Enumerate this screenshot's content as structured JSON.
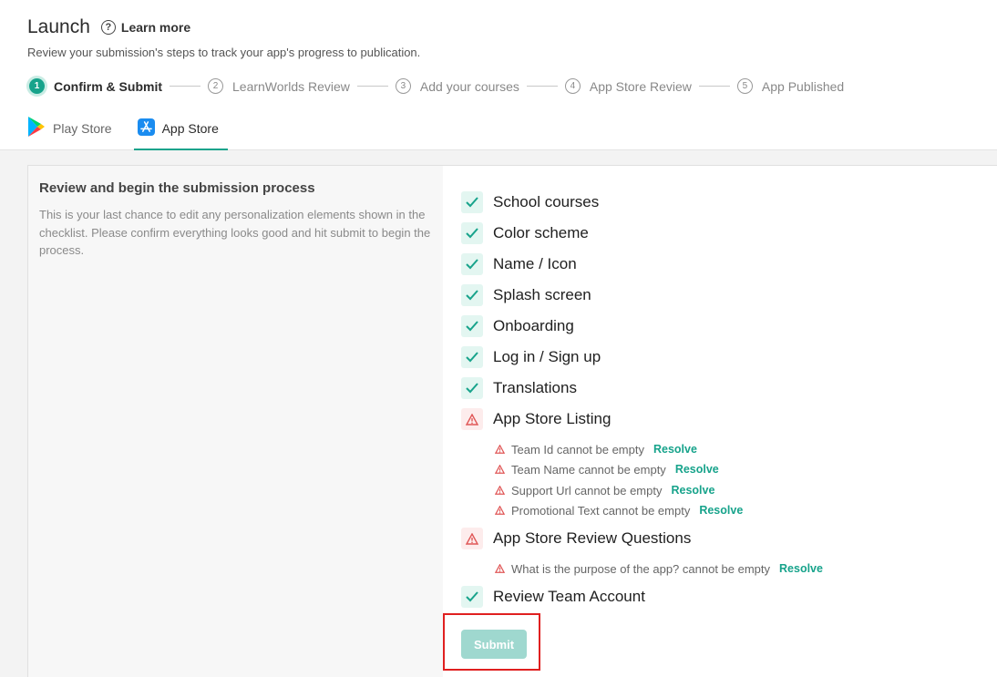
{
  "header": {
    "title": "Launch",
    "learn_more": "Learn more",
    "subtitle": "Review your submission's steps to track your app's progress to publication."
  },
  "steps": [
    {
      "num": "1",
      "label": "Confirm & Submit"
    },
    {
      "num": "2",
      "label": "LearnWorlds Review"
    },
    {
      "num": "3",
      "label": "Add your courses"
    },
    {
      "num": "4",
      "label": "App Store Review"
    },
    {
      "num": "5",
      "label": "App Published"
    }
  ],
  "tabs": [
    {
      "label": "Play Store"
    },
    {
      "label": "App Store"
    }
  ],
  "left_panel": {
    "title": "Review and begin the submission process",
    "description": "This is your last chance to edit any personalization elements shown in the checklist. Please confirm everything looks good and hit submit to begin the process."
  },
  "checklist": [
    {
      "label": "School courses",
      "status": "ok"
    },
    {
      "label": "Color scheme",
      "status": "ok"
    },
    {
      "label": "Name / Icon",
      "status": "ok"
    },
    {
      "label": "Splash screen",
      "status": "ok"
    },
    {
      "label": "Onboarding",
      "status": "ok"
    },
    {
      "label": "Log in / Sign up",
      "status": "ok"
    },
    {
      "label": "Translations",
      "status": "ok"
    },
    {
      "label": "App Store Listing",
      "status": "error",
      "errors": [
        {
          "text": "Team Id cannot be empty",
          "action": "Resolve"
        },
        {
          "text": "Team Name cannot be empty",
          "action": "Resolve"
        },
        {
          "text": "Support Url cannot be empty",
          "action": "Resolve"
        },
        {
          "text": "Promotional Text cannot be empty",
          "action": "Resolve"
        }
      ]
    },
    {
      "label": "App Store Review Questions",
      "status": "error",
      "errors": [
        {
          "text": "What is the purpose of the app? cannot be empty",
          "action": "Resolve"
        }
      ]
    },
    {
      "label": "Review Team Account",
      "status": "ok"
    }
  ],
  "submit_label": "Submit",
  "colors": {
    "accent": "#17a38b",
    "error": "#e05656",
    "submit_disabled": "#9fd8cf"
  },
  "icons": {
    "check": "check-icon",
    "warning": "warning-triangle-icon",
    "help": "help-circle-icon",
    "play_store": "play-store-icon",
    "app_store": "app-store-icon"
  }
}
